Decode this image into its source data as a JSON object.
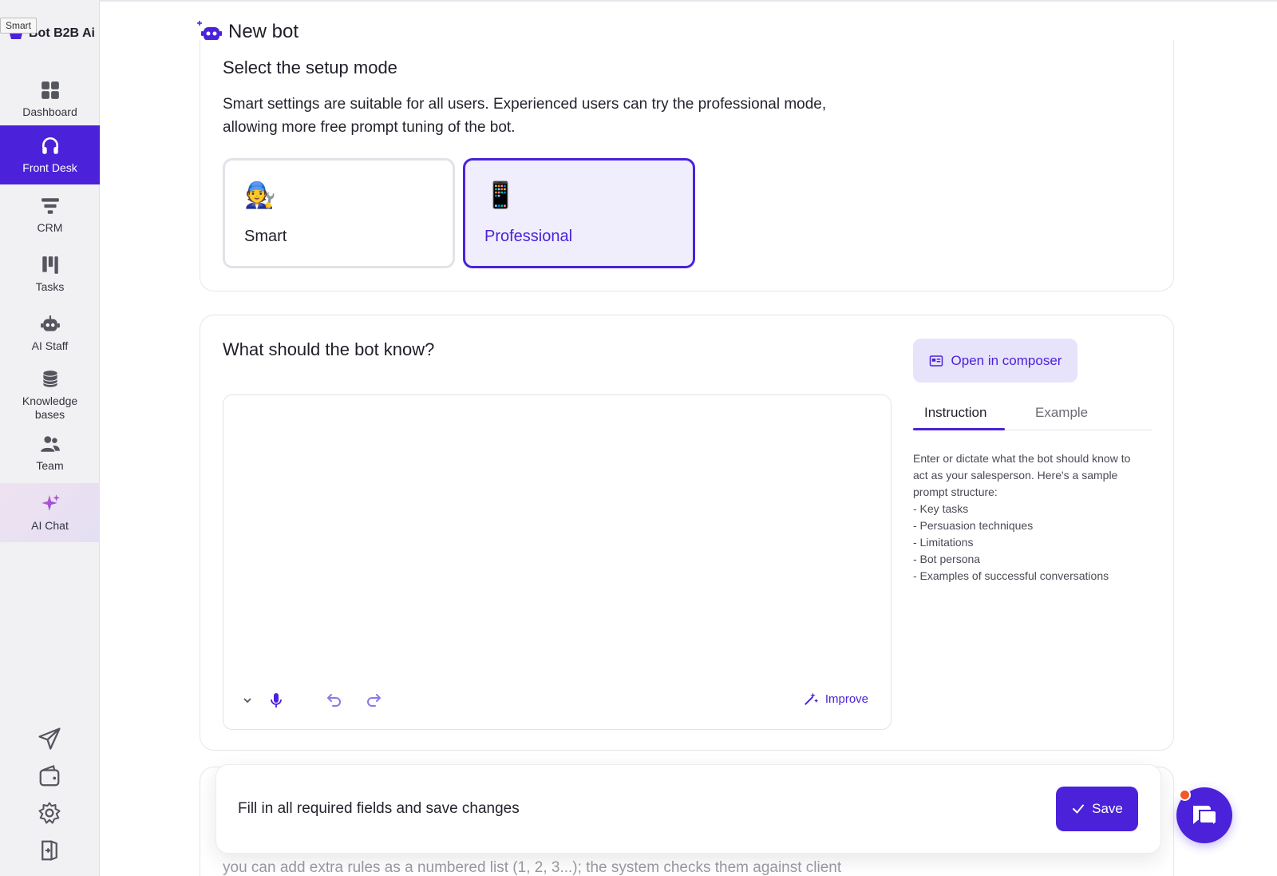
{
  "sidebar": {
    "tooltip": "Smart",
    "brand": "Bot B2B Ai",
    "items": [
      {
        "label": "Dashboard"
      },
      {
        "label": "Front Desk"
      },
      {
        "label": "CRM"
      },
      {
        "label": "Tasks"
      },
      {
        "label": "AI Staff"
      },
      {
        "label": "Knowledge bases"
      },
      {
        "label": "Team"
      },
      {
        "label": "AI Chat"
      }
    ]
  },
  "header": {
    "title": "New bot"
  },
  "setup": {
    "title": "Select the setup mode",
    "description": "Smart settings are suitable for all users. Experienced users can try the professional mode, allowing more free prompt tuning of the bot.",
    "modes": [
      {
        "emoji": "🧑‍🔧",
        "label": "Smart"
      },
      {
        "emoji": "📱",
        "label": "Professional"
      }
    ],
    "selected": "Professional"
  },
  "knowledge": {
    "title": "What should the bot know?",
    "composer_button": "Open in composer",
    "improve_label": "Improve",
    "tabs": [
      "Instruction",
      "Example"
    ],
    "active_tab": "Instruction",
    "instruction_lines": [
      "Enter or dictate what the bot should know to",
      "act as your salesperson. Here's a sample",
      "prompt structure:",
      "- Key tasks",
      "- Persuasion techniques",
      "- Limitations",
      "- Bot persona",
      "- Examples of successful conversations"
    ]
  },
  "faded_text": "you can add extra rules as a numbered list (1, 2, 3...); the system checks them against client",
  "savebar": {
    "message": "Fill in all required fields and save changes",
    "save_label": "Save"
  },
  "colors": {
    "accent": "#4b22d9",
    "accent_light": "#e7e3fb",
    "notification": "#f05a28"
  }
}
